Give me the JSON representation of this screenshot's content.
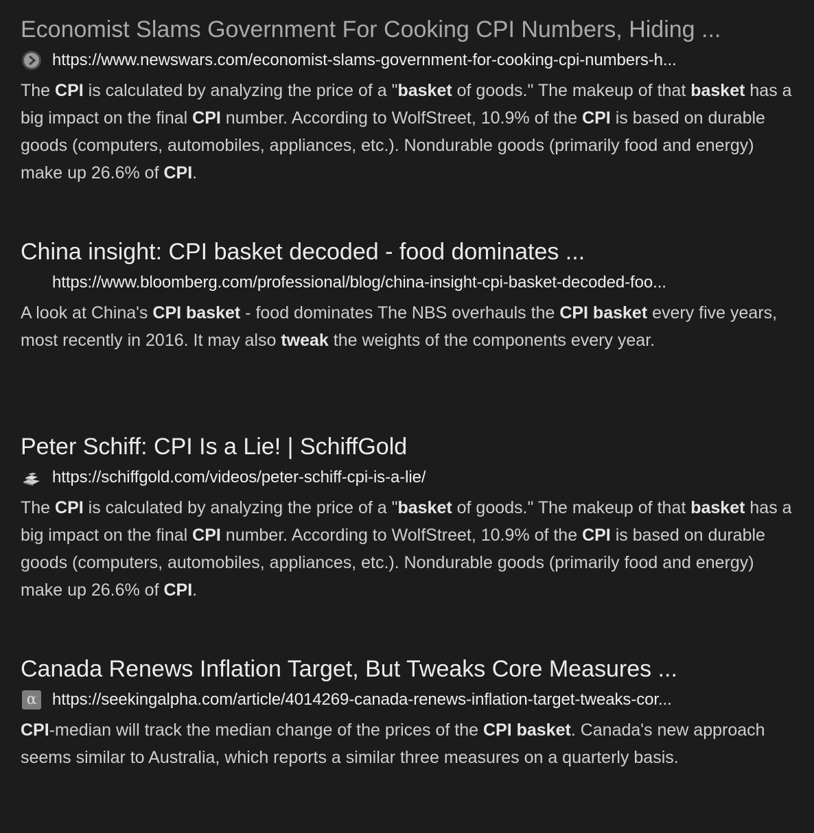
{
  "results": [
    {
      "title": "Economist Slams Government For Cooking CPI Numbers, Hiding ...",
      "url": "https://www.newswars.com/economist-slams-government-for-cooking-cpi-numbers-h...",
      "favicon": "newswars-circle-arrow-icon",
      "snippet": [
        {
          "t": "The ",
          "b": false
        },
        {
          "t": "CPI",
          "b": true
        },
        {
          "t": " is calculated by analyzing the price of a \"",
          "b": false
        },
        {
          "t": "basket",
          "b": true
        },
        {
          "t": " of goods.\" The makeup of that ",
          "b": false
        },
        {
          "t": "basket",
          "b": true
        },
        {
          "t": " has a big impact on the final ",
          "b": false
        },
        {
          "t": "CPI",
          "b": true
        },
        {
          "t": " number. According to WolfStreet, 10.9% of the ",
          "b": false
        },
        {
          "t": "CPI",
          "b": true
        },
        {
          "t": " is based on durable goods (computers, automobiles, appliances, etc.). Nondurable goods (primarily food and energy) make up 26.6% of ",
          "b": false
        },
        {
          "t": "CPI",
          "b": true
        },
        {
          "t": ".",
          "b": false
        }
      ]
    },
    {
      "title": "China insight: CPI basket decoded - food dominates ...",
      "url": "https://www.bloomberg.com/professional/blog/china-insight-cpi-basket-decoded-foo...",
      "favicon": "blank-icon",
      "snippet": [
        {
          "t": "A look at China's ",
          "b": false
        },
        {
          "t": "CPI basket",
          "b": true
        },
        {
          "t": " - food dominates The NBS overhauls the ",
          "b": false
        },
        {
          "t": "CPI basket",
          "b": true
        },
        {
          "t": " every five years, most recently in 2016. It may also ",
          "b": false
        },
        {
          "t": "tweak",
          "b": true
        },
        {
          "t": " the weights of the components every year.",
          "b": false
        }
      ]
    },
    {
      "title": "Peter Schiff: CPI Is a Lie! | SchiffGold",
      "url": "https://schiffgold.com/videos/peter-schiff-cpi-is-a-lie/",
      "favicon": "gold-bars-icon",
      "snippet": [
        {
          "t": "The ",
          "b": false
        },
        {
          "t": "CPI",
          "b": true
        },
        {
          "t": " is calculated by analyzing the price of a \"",
          "b": false
        },
        {
          "t": "basket",
          "b": true
        },
        {
          "t": " of goods.\" The makeup of that ",
          "b": false
        },
        {
          "t": "basket",
          "b": true
        },
        {
          "t": " has a big impact on the final ",
          "b": false
        },
        {
          "t": "CPI",
          "b": true
        },
        {
          "t": " number. According to WolfStreet, 10.9% of the ",
          "b": false
        },
        {
          "t": "CPI",
          "b": true
        },
        {
          "t": " is based on durable goods (computers, automobiles, appliances, etc.). Nondurable goods (primarily food and energy) make up 26.6% of ",
          "b": false
        },
        {
          "t": "CPI",
          "b": true
        },
        {
          "t": ".",
          "b": false
        }
      ]
    },
    {
      "title": "Canada Renews Inflation Target, But Tweaks Core Measures ...",
      "url": "https://seekingalpha.com/article/4014269-canada-renews-inflation-target-tweaks-cor...",
      "favicon": "alpha-icon",
      "favicon_glyph": "α",
      "snippet": [
        {
          "t": "CPI",
          "b": true
        },
        {
          "t": "-median will track the median change of the prices of the ",
          "b": false
        },
        {
          "t": "CPI basket",
          "b": true
        },
        {
          "t": ". Canada's new approach seems similar to Australia, which reports a similar three measures on a quarterly basis.",
          "b": false
        }
      ]
    }
  ]
}
